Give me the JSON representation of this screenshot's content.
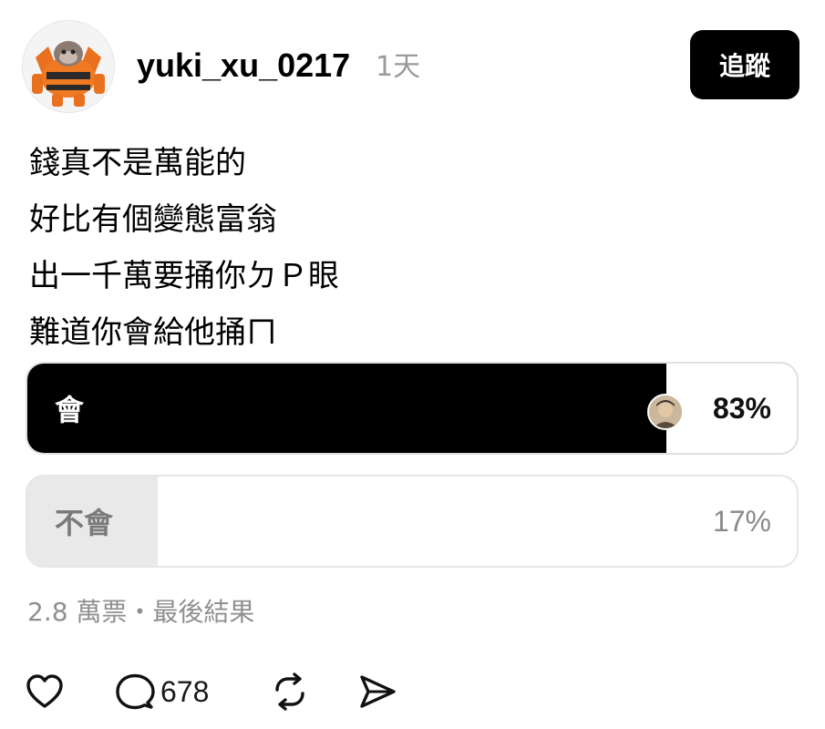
{
  "post": {
    "author": {
      "username": "yuki_xu_0217",
      "timestamp": "1天",
      "avatar_icon": "orange-rock-robot-avatar"
    },
    "follow_label": "追蹤",
    "lines": [
      "錢真不是萬能的",
      "好比有個變態富翁",
      "出一千萬要捅你ㄉＰ眼",
      "難道你會給他捅ㄇ"
    ]
  },
  "poll": {
    "options": [
      {
        "label": "會",
        "percent_text": "83%",
        "percent": 83,
        "fill_color": "#000000",
        "selected": true
      },
      {
        "label": "不會",
        "percent_text": "17%",
        "percent": 17,
        "fill_color": "#e9e9e9",
        "selected": false
      }
    ],
    "summary": "2.8 萬票・最後結果"
  },
  "actions": {
    "like_icon": "heart-icon",
    "comment_icon": "speech-bubble-icon",
    "comment_count": "678",
    "repost_icon": "repost-arrows-icon",
    "share_icon": "paper-plane-icon"
  },
  "colors": {
    "primary": "#000000",
    "muted_text": "#8f8f8f",
    "border": "#e6e6e6"
  }
}
